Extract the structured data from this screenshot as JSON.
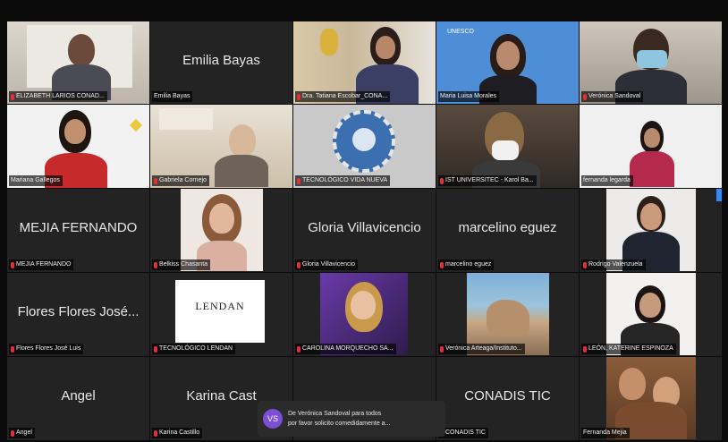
{
  "tiles": [
    {
      "name": "ELIZABETH LARIOS CONAD...",
      "big": "",
      "muted": true
    },
    {
      "name": "Emilia Bayas",
      "big": "Emilia Bayas",
      "muted": false
    },
    {
      "name": "Dra. Tatiana Escobar_CONA...",
      "big": "",
      "muted": true
    },
    {
      "name": "Maria Luisa Morales",
      "big": "",
      "muted": false
    },
    {
      "name": "Verónica Sandoval",
      "big": "",
      "muted": true
    },
    {
      "name": "Mariana Gallegos",
      "big": "",
      "muted": false
    },
    {
      "name": "Gabriela Cornejo",
      "big": "",
      "muted": true
    },
    {
      "name": "TECNOLÓGICO VIDA NUEVA",
      "big": "",
      "muted": true
    },
    {
      "name": "IST UNIVERSITEC - Karol Ba...",
      "big": "",
      "muted": true
    },
    {
      "name": "fernanda legarda",
      "big": "",
      "muted": true
    },
    {
      "name": "MEJIA FERNANDO",
      "big": "MEJIA FERNANDO",
      "muted": true
    },
    {
      "name": "Belkiss Chasanta",
      "big": "",
      "muted": true
    },
    {
      "name": "Gloria Villavicencio",
      "big": "Gloria Villavicencio",
      "muted": true
    },
    {
      "name": "marcelino eguez",
      "big": "marcelino eguez",
      "muted": true
    },
    {
      "name": "Rodrigo Valenzuela",
      "big": "",
      "muted": true
    },
    {
      "name": "Flores Flores José Luis",
      "big": "Flores Flores José...",
      "muted": true
    },
    {
      "name": "TECNOLÓGICO LENDAN",
      "big": "",
      "muted": true
    },
    {
      "name": "CAROLINA MORQUECHO SA...",
      "big": "",
      "muted": true
    },
    {
      "name": "Verónica Arteaga/Instituto...",
      "big": "",
      "muted": true
    },
    {
      "name": "LEÓN, KATERINE ESPINOZA",
      "big": "",
      "muted": true
    },
    {
      "name": "Angel",
      "big": "Angel",
      "muted": true
    },
    {
      "name": "Karina Castillo",
      "big": "Karina Cast",
      "muted": true
    },
    {
      "name": "",
      "big": "",
      "muted": false
    },
    {
      "name": "CONADIS TIC",
      "big": "CONADIS TIC",
      "muted": true
    },
    {
      "name": "Fernanda Mejia",
      "big": "",
      "muted": false
    }
  ],
  "lendan_logo": "LENDAN",
  "unesco": "UNESCO",
  "toast": {
    "avatar": "VS",
    "line1": "De Verónica Sandoval para todos",
    "line2": "por favor solicito comedidamente a..."
  },
  "colors": {
    "active_border": "#c6e27a",
    "mic_muted": "#e0303a",
    "toast_avatar": "#7b4fd6"
  }
}
